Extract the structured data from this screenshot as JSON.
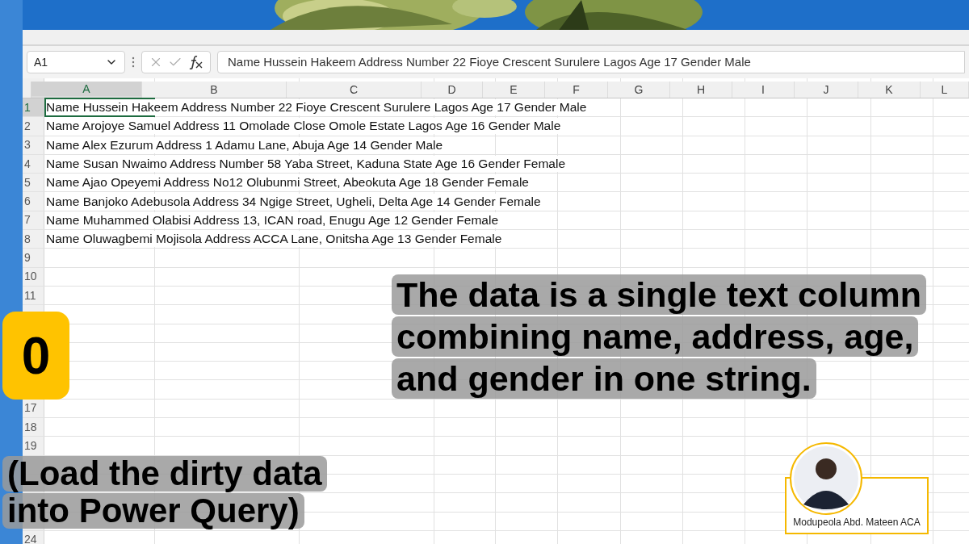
{
  "formula_bar": {
    "name_box": "A1",
    "formula": "Name Hussein Hakeem Address Number 22 Fioye Crescent Surulere Lagos Age 17 Gender Male"
  },
  "columns": [
    {
      "label": "A",
      "selected": true
    },
    {
      "label": "B",
      "selected": false
    },
    {
      "label": "C",
      "selected": false
    },
    {
      "label": "D",
      "selected": false
    },
    {
      "label": "E",
      "selected": false
    },
    {
      "label": "F",
      "selected": false
    },
    {
      "label": "G",
      "selected": false
    },
    {
      "label": "H",
      "selected": false
    },
    {
      "label": "I",
      "selected": false
    },
    {
      "label": "J",
      "selected": false
    },
    {
      "label": "K",
      "selected": false
    },
    {
      "label": "L",
      "selected": false
    }
  ],
  "rows": [
    {
      "number": "1",
      "value": "Name Hussein Hakeem Address Number 22 Fioye Crescent Surulere Lagos Age 17 Gender Male",
      "active": true
    },
    {
      "number": "2",
      "value": "Name Arojoye Samuel Address 11 Omolade Close Omole Estate Lagos Age 16 Gender Male",
      "active": false
    },
    {
      "number": "3",
      "value": "Name Alex Ezurum Address 1 Adamu Lane, Abuja Age 14 Gender Male",
      "active": false
    },
    {
      "number": "4",
      "value": "Name Susan Nwaimo Address Number 58 Yaba Street, Kaduna State  Age 16 Gender Female",
      "active": false
    },
    {
      "number": "5",
      "value": "Name Ajao Opeyemi Address No12 Olubunmi Street, Abeokuta Age 18 Gender Female",
      "active": false
    },
    {
      "number": "6",
      "value": "Name Banjoko Adebusola Address 34 Ngige Street, Ugheli, Delta Age 14 Gender Female",
      "active": false
    },
    {
      "number": "7",
      "value": "Name Muhammed Olabisi Address 13, ICAN road, Enugu Age 12 Gender Female",
      "active": false
    },
    {
      "number": "8",
      "value": "Name Oluwagbemi Mojisola Address ACCA Lane, Onitsha Age 13 Gender Female",
      "active": false
    },
    {
      "number": "9",
      "active": false
    },
    {
      "number": "10",
      "active": false
    },
    {
      "number": "11",
      "active": false
    },
    {},
    {},
    {},
    {},
    {},
    {
      "number": "17",
      "active": false
    },
    {
      "number": "18",
      "active": false
    },
    {
      "number": "19",
      "active": false
    },
    {},
    {},
    {},
    {},
    {
      "number": "24",
      "active": false
    }
  ],
  "step_badge": "0",
  "caption_lines": [
    "The data is a single text column",
    "combining name, address, age,",
    "and gender in one string."
  ],
  "step_title_lines": [
    "(Load the dirty data",
    "into Power Query)"
  ],
  "author": {
    "name": "Modupeola Abd. Mateen ACA"
  }
}
